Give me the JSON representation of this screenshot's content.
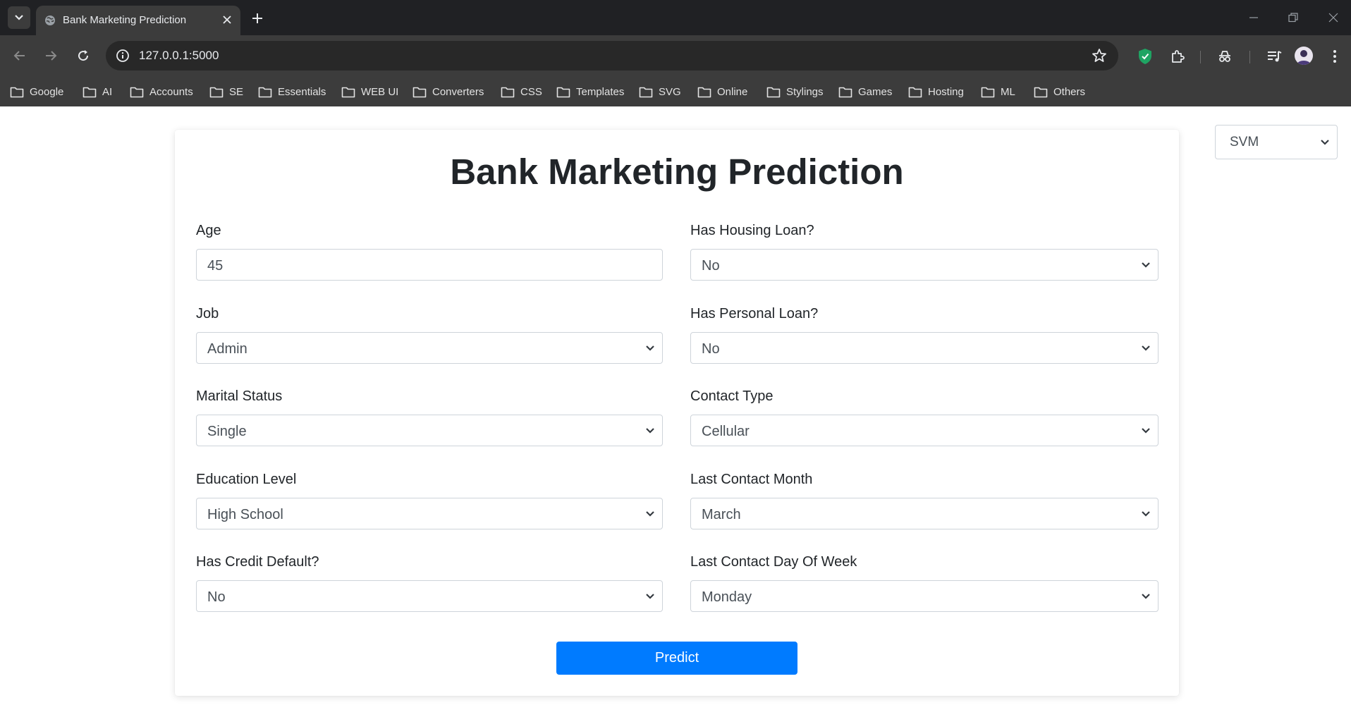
{
  "browser": {
    "tab_title": "Bank Marketing Prediction",
    "url": "127.0.0.1:5000",
    "bookmarks": [
      "Google",
      "AI",
      "Accounts",
      "SE",
      "Essentials",
      "WEB UI",
      "Converters",
      "CSS",
      "Templates",
      "SVG",
      "Online",
      "Stylings",
      "Games",
      "Hosting",
      "ML",
      "Others"
    ]
  },
  "page": {
    "model_select": {
      "value": "SVM"
    },
    "title": "Bank Marketing Prediction",
    "fields": {
      "age": {
        "label": "Age",
        "value": "45"
      },
      "job": {
        "label": "Job",
        "value": "Admin"
      },
      "marital": {
        "label": "Marital Status",
        "value": "Single"
      },
      "education": {
        "label": "Education Level",
        "value": "High School"
      },
      "default": {
        "label": "Has Credit Default?",
        "value": "No"
      },
      "housing": {
        "label": "Has Housing Loan?",
        "value": "No"
      },
      "loan": {
        "label": "Has Personal Loan?",
        "value": "No"
      },
      "contact": {
        "label": "Contact Type",
        "value": "Cellular"
      },
      "month": {
        "label": "Last Contact Month",
        "value": "March"
      },
      "day_of_week": {
        "label": "Last Contact Day Of Week",
        "value": "Monday"
      }
    },
    "predict_label": "Predict"
  },
  "colors": {
    "primary": "#007bff",
    "chrome_dark": "#202124",
    "chrome_toolbar": "#3c3c3c",
    "text": "#212529",
    "input_text": "#495057",
    "input_border": "#ced4da"
  }
}
